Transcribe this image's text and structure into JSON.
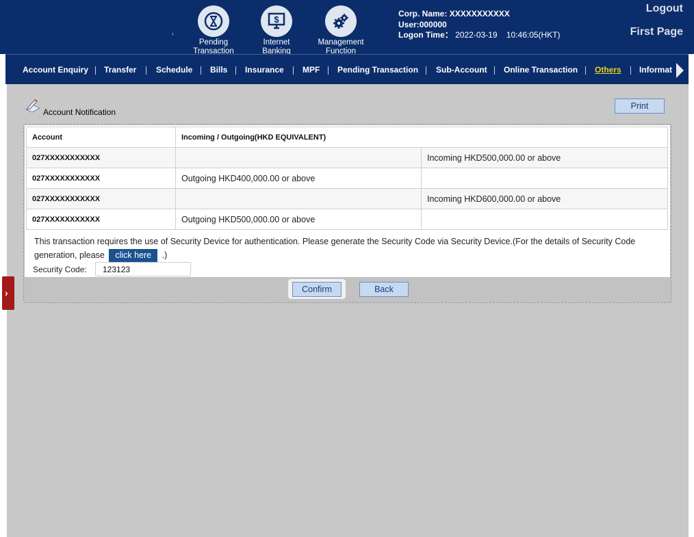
{
  "header": {
    "icons": [
      {
        "name": "pending-transaction-icon",
        "label1": "Pending",
        "label2": "Transaction"
      },
      {
        "name": "internet-banking-icon",
        "label1": "Internet",
        "label2": "Banking"
      },
      {
        "name": "management-function-icon",
        "label1": "Management",
        "label2": "Function"
      }
    ],
    "corp_label": "Corp. Name:",
    "corp_value": "XXXXXXXXXXX",
    "user_label": "User:",
    "user_value": "000000",
    "logon_label": "Logon Time：",
    "logon_value": "2022-03-19    10:46:05(HKT)",
    "logout": "Logout",
    "first_page": "First Page"
  },
  "nav": {
    "items": [
      "Account Enquiry",
      "Transfer",
      "Schedule",
      "Bills",
      "Insurance",
      "MPF",
      "Pending Transaction",
      "Sub-Account",
      "Online Transaction",
      "Others",
      "Informat"
    ],
    "active": "Others"
  },
  "page": {
    "title": "Account Notification",
    "print": "Print"
  },
  "table": {
    "headers": [
      "Account",
      "Incoming / Outgoing(HKD EQUIVALENT)"
    ],
    "rows": [
      {
        "account": "027XXXXXXXXXXX",
        "outgoing": "",
        "incoming": "Incoming HKD500,000.00 or above"
      },
      {
        "account": "027XXXXXXXXXXX",
        "outgoing": "Outgoing HKD400,000.00 or above",
        "incoming": ""
      },
      {
        "account": "027XXXXXXXXXXX",
        "outgoing": "",
        "incoming": "Incoming HKD600,000.00 or above"
      },
      {
        "account": "027XXXXXXXXXXX",
        "outgoing": "Outgoing HKD500,000.00 or above",
        "incoming": ""
      }
    ]
  },
  "security": {
    "message_pre": "This transaction requires the use of Security Device for authentication. Please generate the Security Code via Security Device.(For the details of Security Code generation, please",
    "click_here": "click here",
    "message_post": ".)",
    "label": "Security Code:",
    "value": "123123"
  },
  "buttons": {
    "confirm": "Confirm",
    "back": "Back"
  },
  "colors": {
    "header_bg": "#0b2d6b",
    "active_nav": "#e8d020",
    "button_bg": "#c6d9f1",
    "side_tab": "#a21a1a"
  }
}
